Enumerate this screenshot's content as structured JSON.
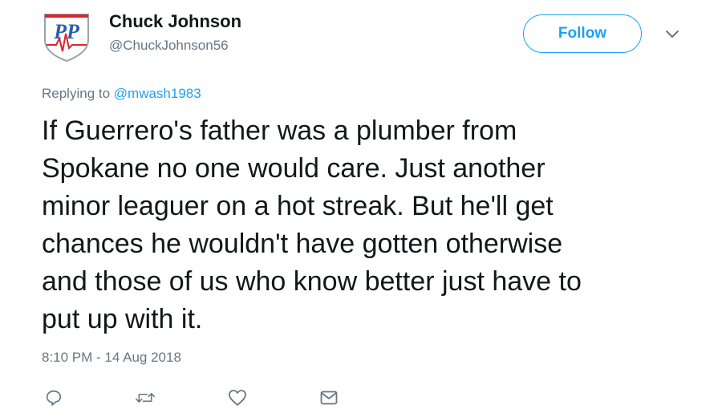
{
  "author": {
    "name": "Chuck Johnson",
    "handle": "@ChuckJohnson56",
    "avatar_monogram": "PP"
  },
  "follow_button": {
    "label": "Follow"
  },
  "reply_context": {
    "prefix": "Replying to ",
    "handle": "@mwash1983"
  },
  "tweet": {
    "text": "If Guerrero's father was a plumber from\nSpokane no one would care. Just another\nminor leaguer on a hot streak. But he'll get\nchances he wouldn't have gotten otherwise\nand those of us who know better just have to\nput up with it.",
    "timestamp": "8:10 PM - 14 Aug 2018"
  },
  "actions": [
    "reply-icon",
    "retweet-icon",
    "like-icon",
    "message-icon"
  ],
  "colors": {
    "accent": "#1da1f2",
    "text": "#14171a",
    "muted": "#657786",
    "avatar_red": "#e0242c",
    "avatar_blue": "#2a5db0"
  }
}
